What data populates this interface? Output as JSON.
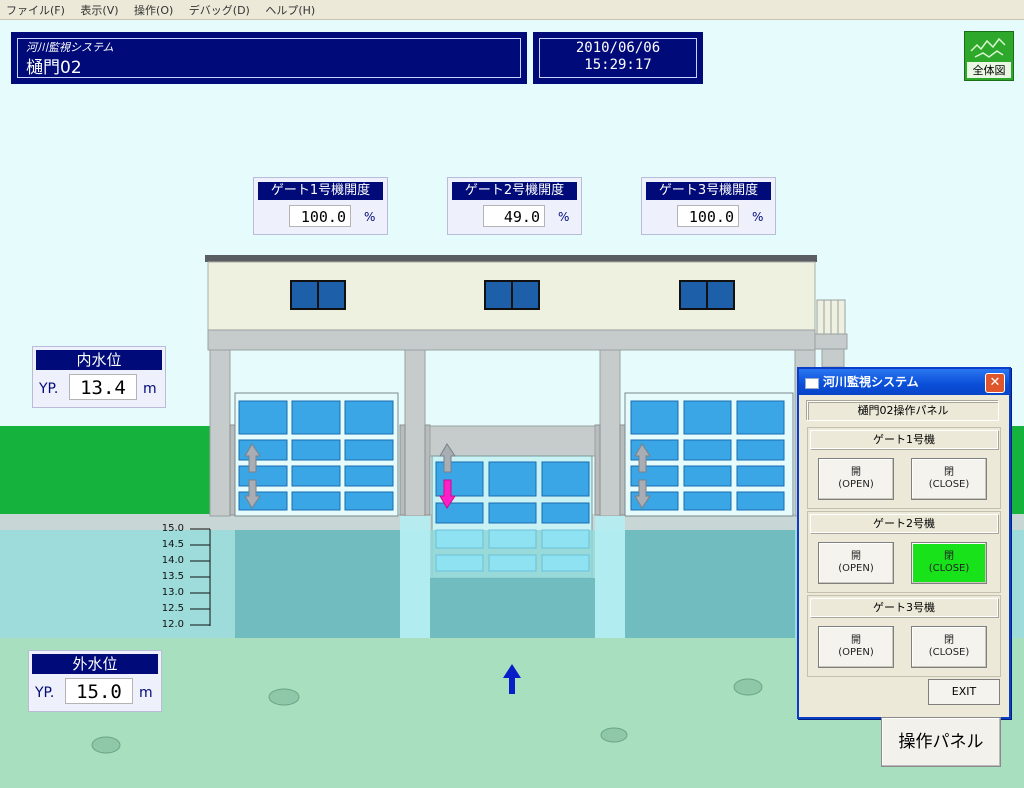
{
  "menu": [
    "ファイル(F)",
    "表示(V)",
    "操作(O)",
    "デバッグ(D)",
    "ヘルプ(H)"
  ],
  "header": {
    "system_name": "河川監視システム",
    "facility_name": "樋門02",
    "date": "2010/06/06",
    "time": "15:29:17",
    "overview_label": "全体図"
  },
  "gates": [
    {
      "label": "ゲート1号機開度",
      "opening": "100.0",
      "unit": "%",
      "opening_fraction": 1.0
    },
    {
      "label": "ゲート2号機開度",
      "opening": "49.0",
      "unit": "%",
      "opening_fraction": 0.49
    },
    {
      "label": "ゲート3号機開度",
      "opening": "100.0",
      "unit": "%",
      "opening_fraction": 1.0
    }
  ],
  "inner_water": {
    "label": "内水位",
    "prefix": "YP.",
    "value": "13.4",
    "unit": "m"
  },
  "outer_water": {
    "label": "外水位",
    "prefix": "YP.",
    "value": "15.0",
    "unit": "m"
  },
  "scale": [
    "15.0",
    "14.5",
    "14.0",
    "13.5",
    "13.0",
    "12.5",
    "12.0"
  ],
  "dialog": {
    "title": "河川監視システム",
    "close_glyph": "✕",
    "panel_title": "樋門02操作パネル",
    "groups": [
      {
        "label": "ゲート1号機",
        "open": {
          "line1": "開",
          "line2": "(OPEN)"
        },
        "close": {
          "line1": "閉",
          "line2": "(CLOSE)"
        },
        "close_active": false
      },
      {
        "label": "ゲート2号機",
        "open": {
          "line1": "開",
          "line2": "(OPEN)"
        },
        "close": {
          "line1": "閉",
          "line2": "(CLOSE)"
        },
        "close_active": true
      },
      {
        "label": "ゲート3号機",
        "open": {
          "line1": "開",
          "line2": "(OPEN)"
        },
        "close": {
          "line1": "閉",
          "line2": "(CLOSE)"
        },
        "close_active": false
      }
    ],
    "exit_label": "EXIT"
  },
  "operation_panel_label": "操作パネル",
  "colors": {
    "navy": "#000a78",
    "active_green": "#17e21a",
    "moving_arrow": "#ff1ec8",
    "flow_arrow": "#0a1ec8"
  }
}
